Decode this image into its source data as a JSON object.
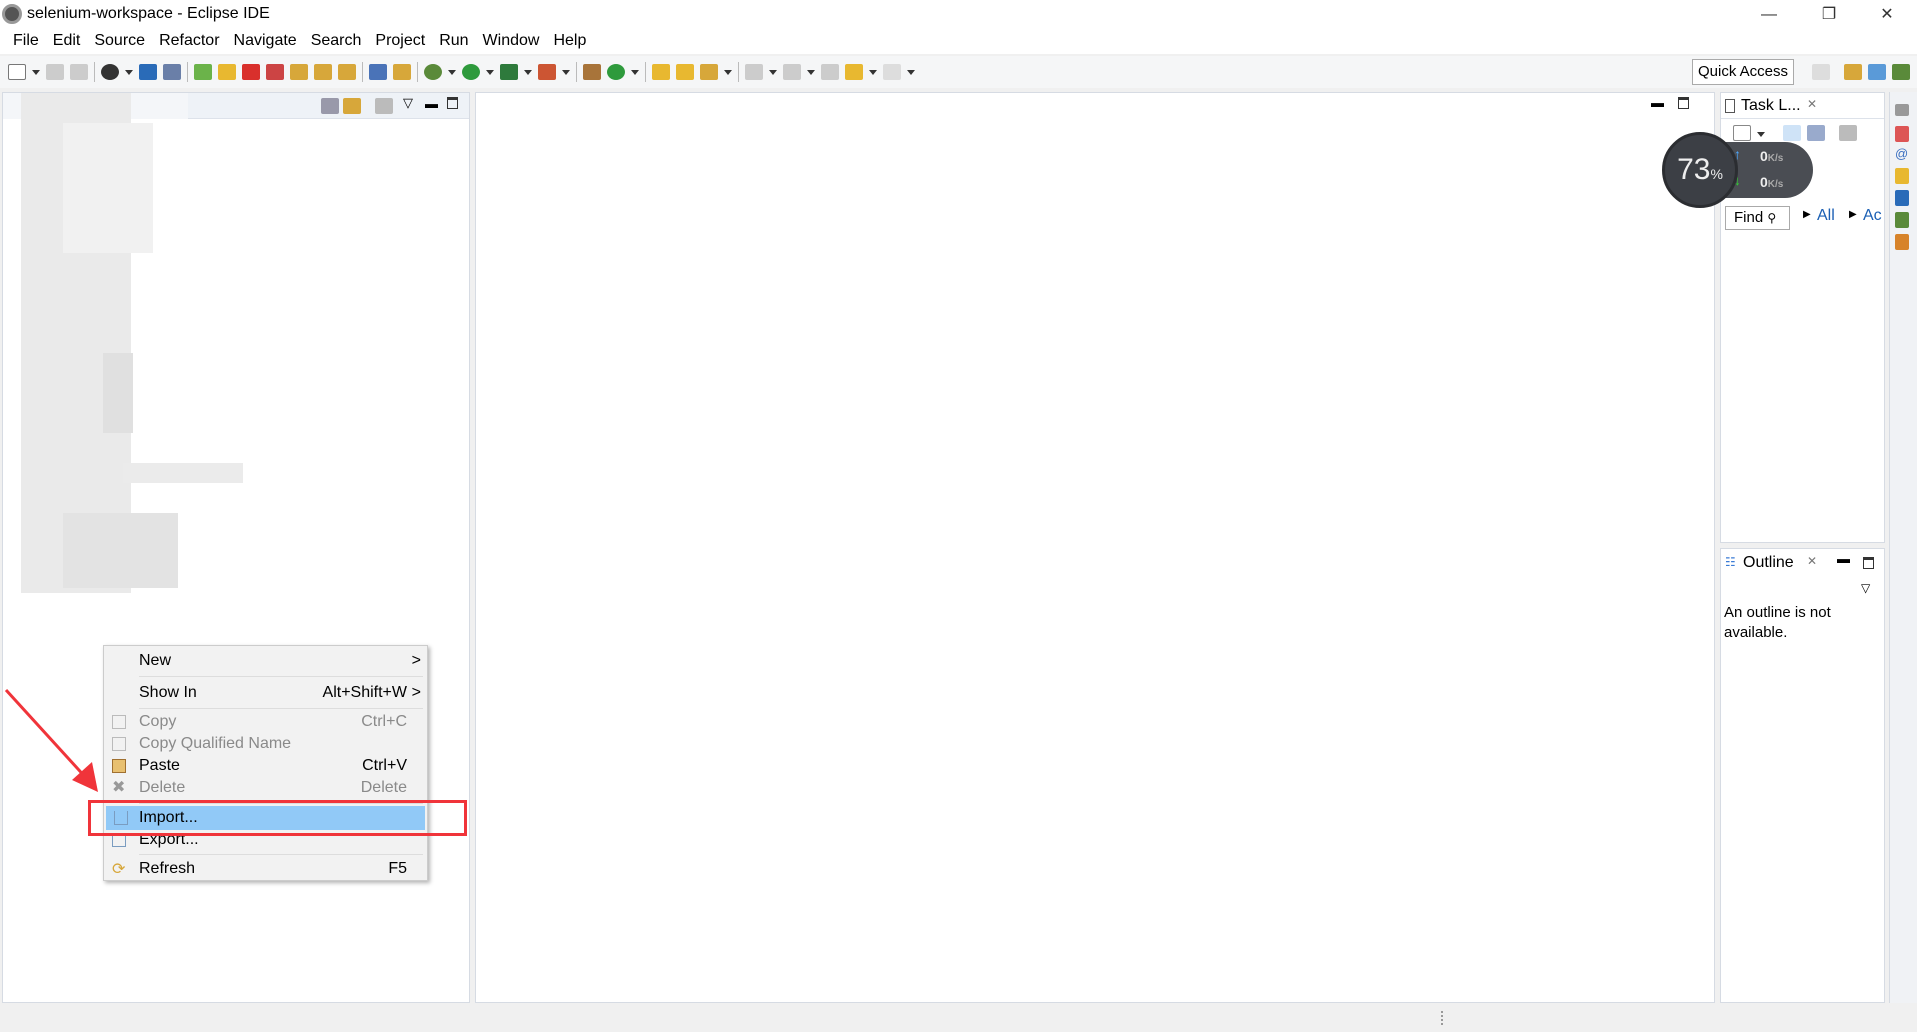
{
  "window": {
    "title": "selenium-workspace - Eclipse IDE",
    "minimize": "—",
    "restore": "❐",
    "close": "✕"
  },
  "menubar": [
    "File",
    "Edit",
    "Source",
    "Refactor",
    "Navigate",
    "Search",
    "Project",
    "Run",
    "Window",
    "Help"
  ],
  "toolbar": {
    "quick_access": "Quick Access"
  },
  "context_menu": {
    "items": [
      {
        "label": "New",
        "shortcut": "",
        "submenu": ">",
        "enabled": true
      },
      {
        "label": "Show In",
        "shortcut": "Alt+Shift+W",
        "submenu": ">",
        "enabled": true
      },
      {
        "label": "Copy",
        "shortcut": "Ctrl+C",
        "enabled": false
      },
      {
        "label": "Copy Qualified Name",
        "shortcut": "",
        "enabled": false
      },
      {
        "label": "Paste",
        "shortcut": "Ctrl+V",
        "enabled": true
      },
      {
        "label": "Delete",
        "shortcut": "Delete",
        "enabled": false
      },
      {
        "label": "Import...",
        "shortcut": "",
        "enabled": true,
        "highlighted": true
      },
      {
        "label": "Export...",
        "shortcut": "",
        "enabled": true
      },
      {
        "label": "Refresh",
        "shortcut": "F5",
        "enabled": true
      }
    ],
    "highlight_color": "#91c9f7"
  },
  "task_list": {
    "title": "Task L...",
    "find": "Find",
    "all": "All",
    "activate": "Ac"
  },
  "outline": {
    "title": "Outline",
    "message": "An outline is not available."
  },
  "net_widget": {
    "percent": "73",
    "percent_sign": "%",
    "up": "0",
    "down": "0",
    "unit": "K/s"
  },
  "annotation_color": "#f0343a"
}
